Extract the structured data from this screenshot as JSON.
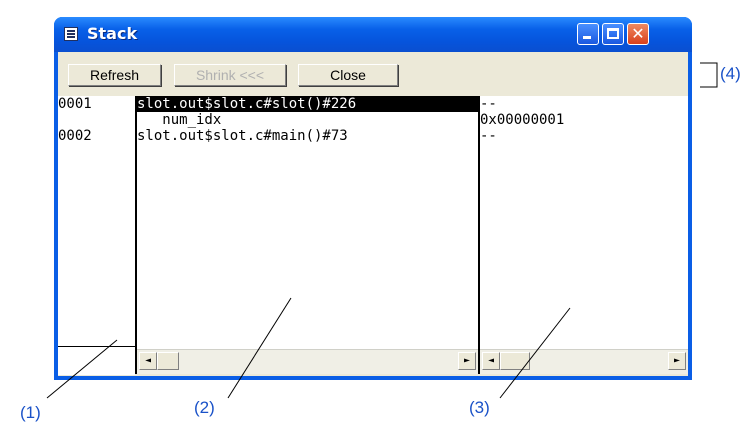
{
  "window": {
    "title": "Stack",
    "icon": "window-menu-icon"
  },
  "title_buttons": {
    "minimize": "minimize-icon",
    "maximize": "maximize-icon",
    "close": "close-icon",
    "close_glyph": "✕"
  },
  "toolbar": {
    "refresh_label": "Refresh",
    "shrink_label": "Shrink <<<",
    "close_label": "Close"
  },
  "left_pane": {
    "rows": [
      "0001",
      "",
      "0002"
    ]
  },
  "middle_pane": {
    "rows": [
      "slot.out$slot.c#slot()#226",
      "   num_idx",
      "slot.out$slot.c#main()#73"
    ],
    "selected_index": 0
  },
  "right_pane": {
    "rows": [
      "--",
      "0x00000001",
      "--"
    ]
  },
  "scroll_arrows": {
    "left": "◄",
    "right": "►"
  },
  "annotations": {
    "one": "(1)",
    "two": "(2)",
    "three": "(3)",
    "four": "(4)"
  }
}
